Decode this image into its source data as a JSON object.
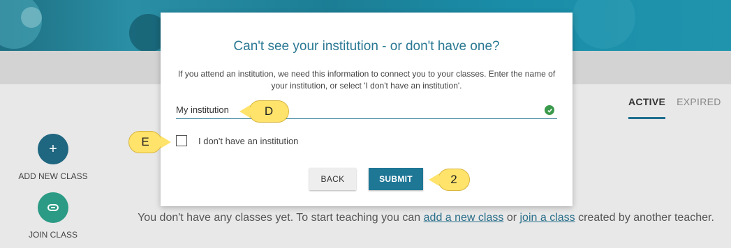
{
  "tabs": [
    {
      "label": "ACTIVE",
      "active": true
    },
    {
      "label": "EXPIRED",
      "active": false
    }
  ],
  "side_actions": {
    "add_label": "ADD NEW CLASS",
    "add_icon": "+",
    "join_label": "JOIN CLASS"
  },
  "empty_message": {
    "prefix": "You don't have any classes yet. To start teaching you can ",
    "link1": "add a new class",
    "middle": " or ",
    "link2": "join a class",
    "suffix": " created by another teacher."
  },
  "dialog": {
    "title": "Can't see your institution - or don't have one?",
    "description": "If you attend an institution, we need this information to connect you to your classes. Enter the name of your institution, or select 'I don't have an institution'.",
    "institution_value": "My institution",
    "no_institution_label": "I don't have an institution",
    "back_label": "BACK",
    "submit_label": "SUBMIT"
  },
  "callouts": {
    "d": "D",
    "e": "E",
    "two": "2"
  },
  "colors": {
    "accent": "#1f7796",
    "title": "#2a7893",
    "join": "#2c9b85",
    "callout": "#ffe36b",
    "valid": "#3a9a4b"
  }
}
